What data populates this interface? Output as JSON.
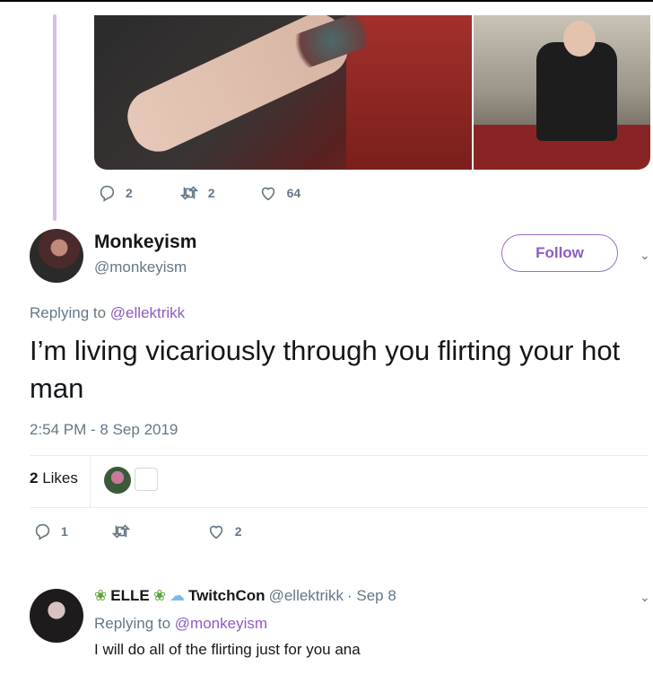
{
  "top_tweet": {
    "stats": {
      "replies": "2",
      "retweets": "2",
      "likes": "64"
    }
  },
  "main_tweet": {
    "author_name": "Monkeyism",
    "author_handle": "@monkeyism",
    "follow_label": "Follow",
    "replying_prefix": "Replying to",
    "replying_handle": "@ellektrikk",
    "text": "I’m living vicariously through you flirting your hot man",
    "timestamp": "2:54 PM - 8 Sep 2019",
    "likes_count": "2",
    "likes_label": "Likes",
    "stats": {
      "replies": "1",
      "retweets": "",
      "likes": "2"
    }
  },
  "reply_tweet": {
    "display_name_1": "ELLE",
    "display_name_2": "TwitchCon",
    "handle": "@ellektrikk",
    "date": "· Sep 8",
    "replying_prefix": "Replying to",
    "replying_handle": "@monkeyism",
    "text": "I will do all of the flirting just for you ana"
  },
  "icons": {
    "reply": "reply-icon",
    "retweet": "retweet-icon",
    "like": "heart-icon",
    "caret": "chevron-down-icon",
    "herb": "herb-emoji-icon",
    "dash": "dash-emoji-icon"
  },
  "colors": {
    "accent": "#8e5bc5",
    "thread_line": "#d4c2e4",
    "muted": "#657786",
    "text": "#14171a"
  }
}
